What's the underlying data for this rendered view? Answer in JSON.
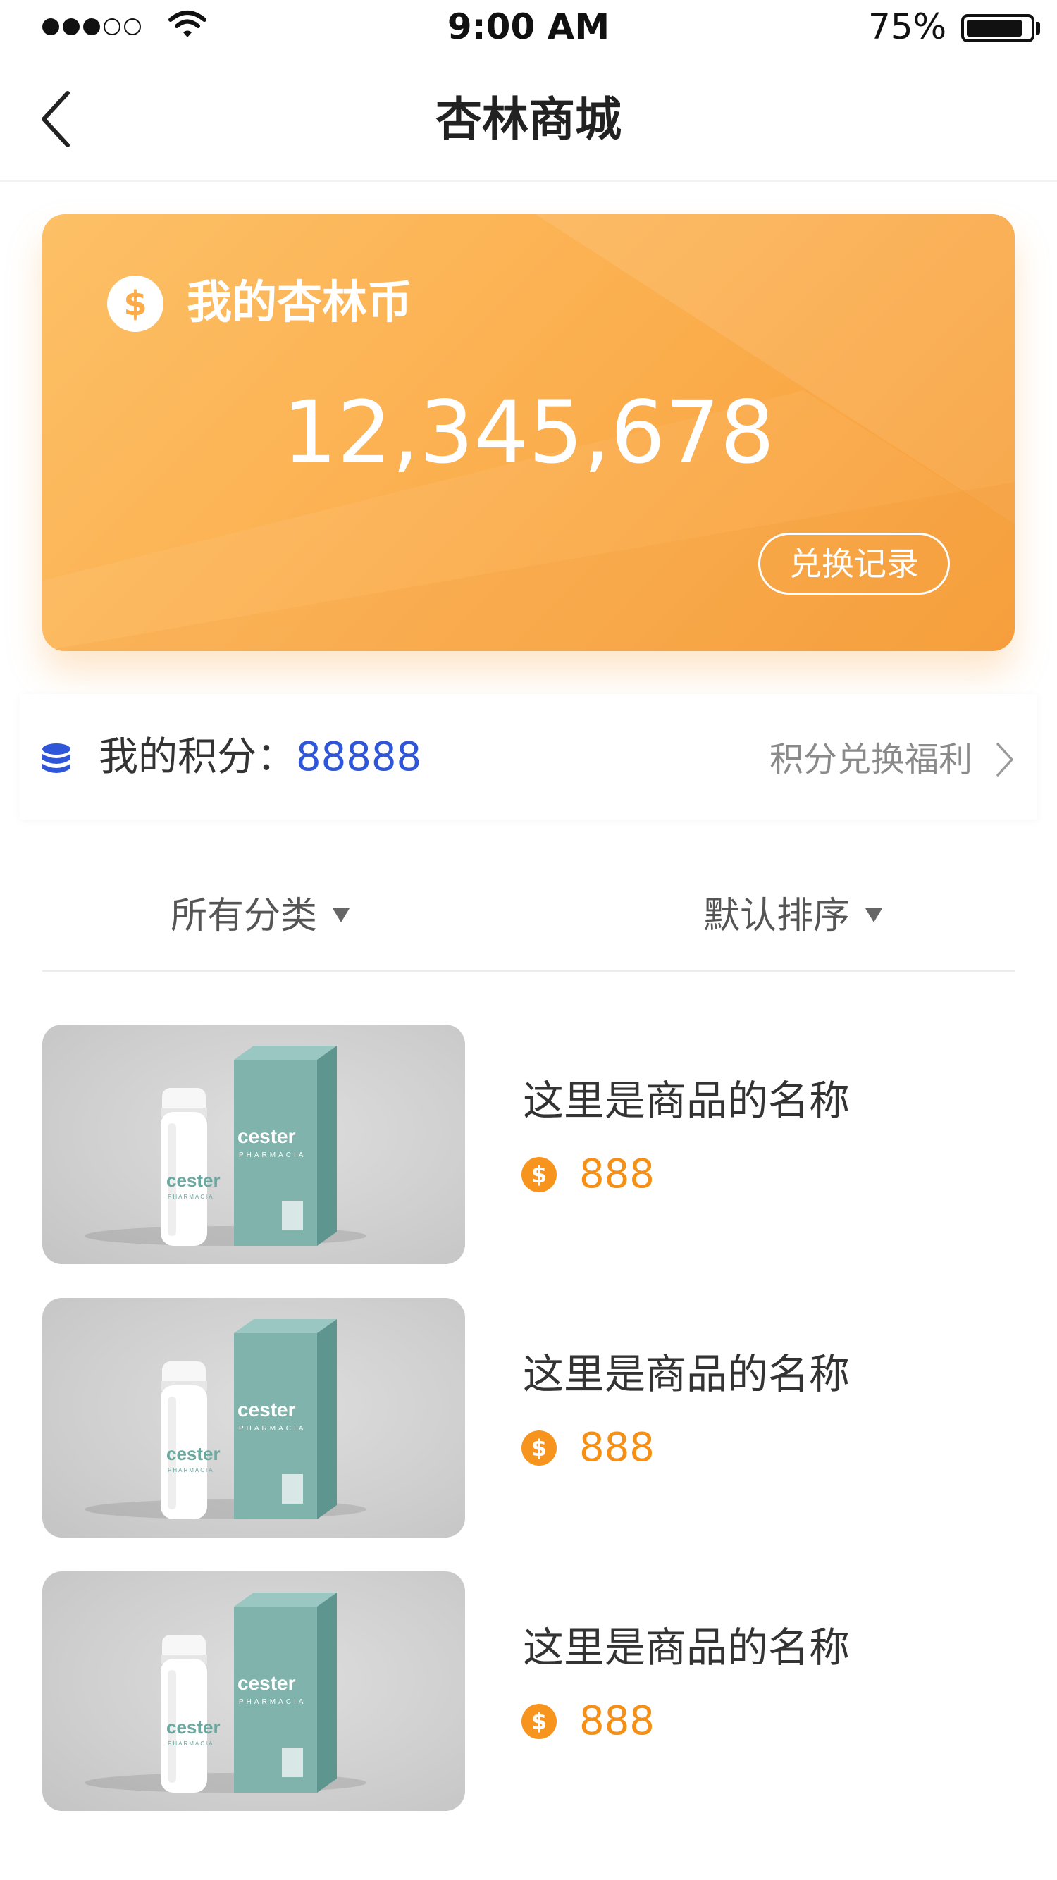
{
  "status_bar": {
    "time": "9:00 AM",
    "battery_pct": "75%"
  },
  "nav": {
    "title": "杏林商城"
  },
  "coin_card": {
    "title": "我的杏林币",
    "amount": "12,345,678",
    "record_button": "兑换记录",
    "coin_symbol": "$"
  },
  "points": {
    "label": "我的积分：",
    "value": "88888",
    "link": "积分兑换福利"
  },
  "filters": {
    "category": "所有分类",
    "sort": "默认排序"
  },
  "products": [
    {
      "name": "这里是商品的名称",
      "price": "888",
      "brand": "cester",
      "sub": "PHARMACIA"
    },
    {
      "name": "这里是商品的名称",
      "price": "888",
      "brand": "cester",
      "sub": "PHARMACIA"
    },
    {
      "name": "这里是商品的名称",
      "price": "888",
      "brand": "cester",
      "sub": "PHARMACIA"
    }
  ],
  "colors": {
    "card_orange": "#fbad4c",
    "points_blue": "#2f56d8",
    "price_orange": "#f58f15"
  }
}
